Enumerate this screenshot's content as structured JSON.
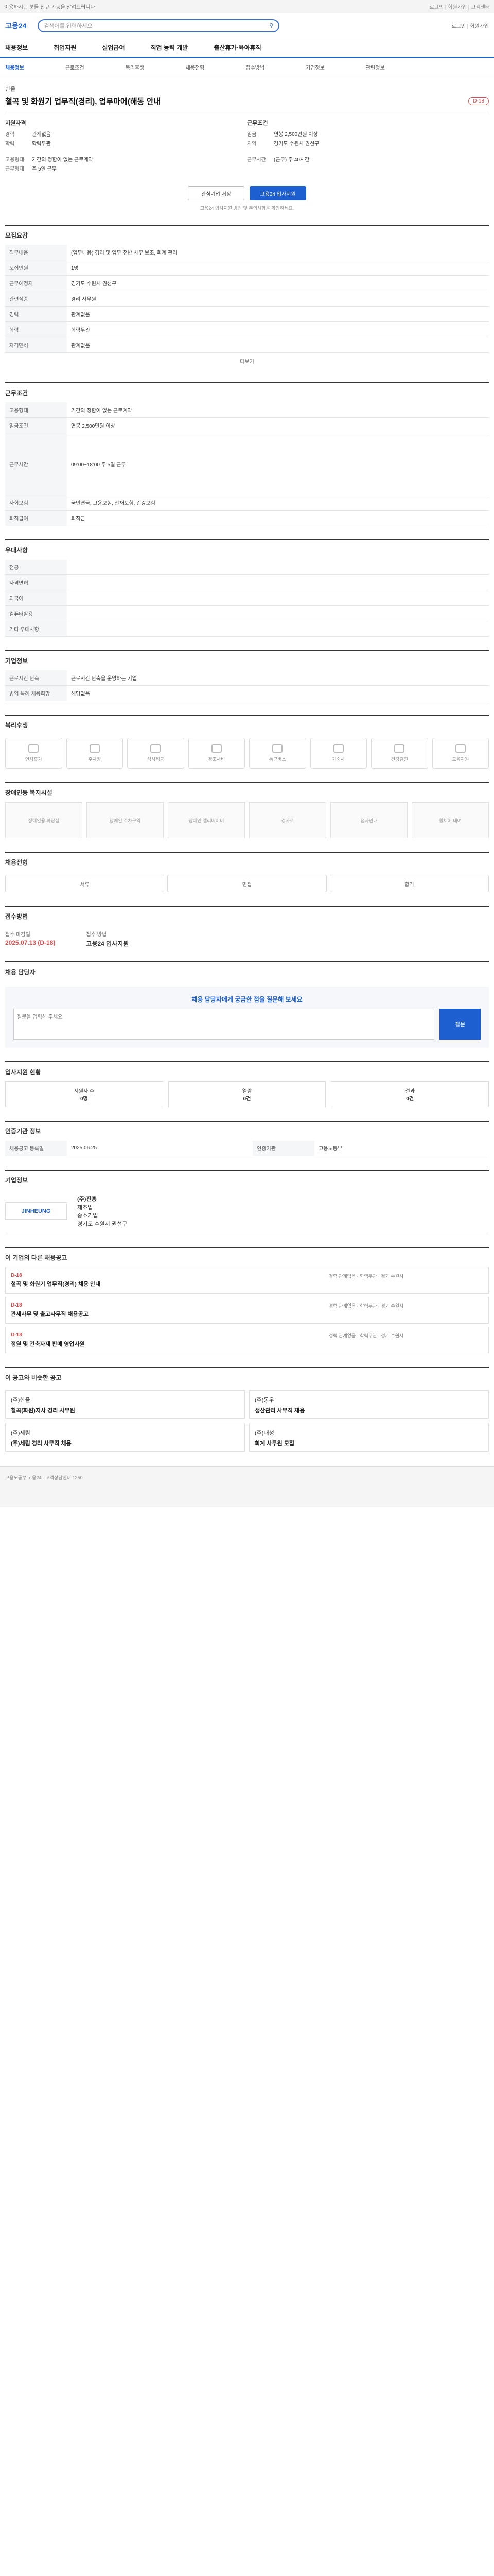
{
  "topbar": {
    "text": "이용하시는 분들 신규 기능을 알려드립니다",
    "right": "로그인 | 회원가입 | 고객센터"
  },
  "header": {
    "logo": "고용24",
    "search_placeholder": "검색어를 입력하세요",
    "right": "로그인 | 회원가입"
  },
  "gnb": [
    "채용정보",
    "취업지원",
    "실업급여",
    "직업 능력 개발",
    "출산휴가·육아휴직"
  ],
  "crumb": [
    "채용정보",
    "근로조건",
    "복리후생",
    "채용전형",
    "접수방법",
    "기업정보",
    "관련정보"
  ],
  "job": {
    "company": "한울",
    "title": "철곡 및 화원기 업무직(경리), 업무마에(해동 안내",
    "badge": "D-18"
  },
  "summary": {
    "left_title": "지원자격",
    "left": [
      [
        "경력",
        "관계없음"
      ],
      [
        "학력",
        "학력무관"
      ]
    ],
    "right_title": "근무조건",
    "right": [
      [
        "임금",
        "연봉 2,500만원 이상"
      ],
      [
        "지역",
        "경기도 수원시 권선구"
      ]
    ],
    "left2": [
      [
        "고용형태",
        "기간의 정함이 없는 근로계약"
      ],
      [
        "근무형태",
        "주 5일 근무"
      ]
    ],
    "right2": [
      [
        "근무시간",
        "(근무) 주 40시간"
      ]
    ]
  },
  "buttons": {
    "interest": "관심기업 저장",
    "apply": "고용24 입사지원"
  },
  "note": "고용24 입사지원 방법 및 주의사항을 확인하세요.",
  "sec1": {
    "title": "모집요강",
    "rows": [
      [
        "직무내용",
        "(업무내용) 경리 및 업무 전반 사무 보조, 회계 관리"
      ],
      [
        "모집인원",
        "1명"
      ],
      [
        "근무예정지",
        "경기도 수원시 권선구"
      ],
      [
        "관련직종",
        "경리 사무원"
      ],
      [
        "경력",
        "관계없음"
      ],
      [
        "학력",
        "학력무관"
      ],
      [
        "자격면허",
        "관계없음"
      ]
    ],
    "more": "더보기"
  },
  "sec2": {
    "title": "근무조건",
    "rows": [
      [
        "고용형태",
        "기간의 정함이 없는 근로계약"
      ],
      [
        "임금조건",
        "연봉 2,500만원 이상"
      ],
      [
        "근무시간",
        "09:00~18:00 주 5일 근무"
      ],
      [
        "사회보험",
        "국민연금, 고용보험, 산재보험, 건강보험"
      ],
      [
        "퇴직급여",
        "퇴직금"
      ]
    ]
  },
  "sec3": {
    "title": "우대사항",
    "rows": [
      [
        "전공",
        ""
      ],
      [
        "자격면허",
        ""
      ],
      [
        "외국어",
        ""
      ],
      [
        "컴퓨터활용",
        ""
      ],
      [
        "기타 우대사항",
        ""
      ]
    ]
  },
  "sec4": {
    "title": "기업정보",
    "rows": [
      [
        "근로시간 단축",
        "근로시간 단축을 운영하는 기업"
      ],
      [
        "병역 특례 채용희망",
        "해당없음"
      ]
    ]
  },
  "welfare_title": "복리후생",
  "welfare": [
    "연차휴가",
    "주차장",
    "식사제공",
    "경조사비",
    "통근버스",
    "기숙사",
    "건강검진",
    "교육지원"
  ],
  "disability_title": "장애인등 복지시설",
  "disability": [
    "장애인용 화장실",
    "장애인 주차구역",
    "장애인 엘리베이터",
    "경사로",
    "점자안내",
    "휠체어 대여"
  ],
  "process_title": "채용전형",
  "process": [
    "서류",
    "면접",
    "합격"
  ],
  "reception_title": "접수방법",
  "deadline": {
    "label1": "접수 마감일",
    "value1": "2025.07.13 (D-18)",
    "label2": "접수 방법",
    "value2": "고용24 입사지원"
  },
  "qa_title": "채용 담당자",
  "qa": {
    "q": "채용 담당자에게 궁금한 점을 질문해 보세요",
    "placeholder": "질문을 입력해 주세요",
    "submit": "질문"
  },
  "status_title": "입사지원 현황",
  "status": [
    [
      "지원자 수",
      "0명"
    ],
    [
      "열람",
      "0건"
    ],
    [
      "결과",
      "0건"
    ]
  ],
  "info_title": "인증기관 정보",
  "info": [
    [
      "채용공고 등록일",
      "2025.06.25"
    ],
    [
      "인증기관",
      "고용노동부"
    ]
  ],
  "company_title": "기업정보",
  "company": {
    "logo": "JINHEUNG",
    "name": "(주)진흥",
    "industry": "제조업",
    "size": "중소기업",
    "addr": "경기도 수원시 권선구"
  },
  "others_title": "이 기업의 다른 채용공고",
  "others": [
    {
      "dday": "D-18",
      "title": "철곡 및 화원기 업무직(경리) 채용 안내",
      "meta": "경력 관계없음 · 학력무관 · 경기 수원시"
    },
    {
      "dday": "D-18",
      "title": "관세사무 및 출고사무직 채용공고",
      "meta": "경력 관계없음 · 학력무관 · 경기 수원시"
    },
    {
      "dday": "D-18",
      "title": "정원 및 건축자재 판매 영업사원",
      "meta": "경력 관계없음 · 학력무관 · 경기 수원시"
    }
  ],
  "rec_title": "이 공고와 비슷한 공고",
  "recs": [
    {
      "company": "(주)한울",
      "title": "철곡(화원)지사 경리 사무원"
    },
    {
      "company": "(주)동우",
      "title": "생산관리 사무직 채용"
    },
    {
      "company": "(주)세림",
      "title": "(주)세림 경리 사무직 채용"
    },
    {
      "company": "(주)대성",
      "title": "회계 사무원 모집"
    }
  ],
  "footer": "고용노동부 고용24 · 고객상담센터 1350"
}
